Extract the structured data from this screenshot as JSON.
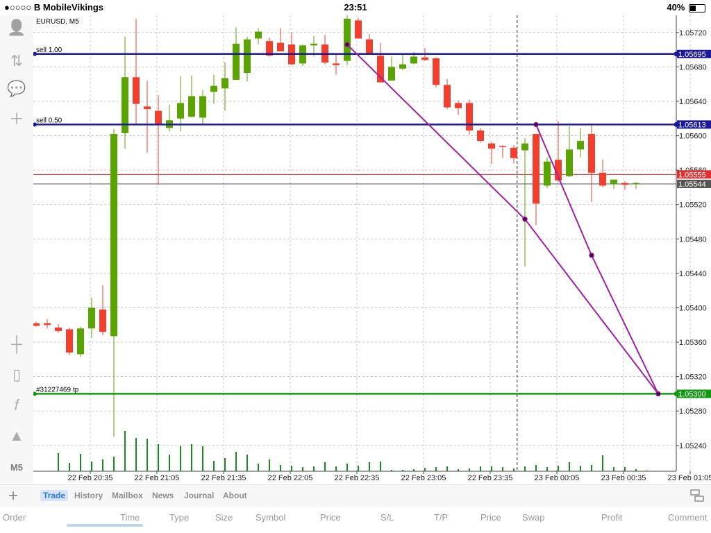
{
  "status_bar": {
    "carrier": "●○○○○ B MobileVikings",
    "time": "23:51",
    "battery": "40%",
    "battery_level": 0.4
  },
  "chart": {
    "symbol_label": "EURUSD, M5",
    "order_lines": [
      {
        "label": "sell 1.00",
        "price": 1.05695,
        "price_text": "1.05695",
        "color": "#1a1a9a"
      },
      {
        "label": "sell 0.50",
        "price": 1.05613,
        "price_text": "1.05613",
        "color": "#1a1a9a"
      },
      {
        "label": "#31227469 tp",
        "price": 1.053,
        "price_text": "1.05300",
        "color": "#119911"
      }
    ],
    "ask_line": {
      "price": 1.05555,
      "price_text": "1.05555",
      "color": "#e03030"
    },
    "bid_line": {
      "price": 1.05544,
      "price_text": "1.05544",
      "color": "#555555"
    }
  },
  "chart_data": {
    "type": "candlestick",
    "symbol": "EURUSD",
    "timeframe": "M5",
    "y_ticks": [
      "1.05720",
      "1.05680",
      "1.05640",
      "1.05600",
      "1.05560",
      "1.05520",
      "1.05480",
      "1.05440",
      "1.05400",
      "1.05360",
      "1.05320",
      "1.05280",
      "1.05240"
    ],
    "x_ticks": [
      "22 Feb 20:35",
      "22 Feb 21:05",
      "22 Feb 21:35",
      "22 Feb 22:05",
      "22 Feb 22:35",
      "22 Feb 23:05",
      "22 Feb 23:35",
      "23 Feb 00:05",
      "23 Feb 00:35",
      "23 Feb 01:05"
    ],
    "ylim": [
      1.0521,
      1.0574
    ],
    "grid": true,
    "candles": [
      {
        "o": 1.05382,
        "h": 1.05384,
        "l": 1.05378,
        "c": 1.05379
      },
      {
        "o": 1.05382,
        "h": 1.05387,
        "l": 1.05376,
        "c": 1.0538
      },
      {
        "o": 1.05377,
        "h": 1.05381,
        "l": 1.05371,
        "c": 1.05373
      },
      {
        "o": 1.05375,
        "h": 1.05377,
        "l": 1.05345,
        "c": 1.05348
      },
      {
        "o": 1.05346,
        "h": 1.05378,
        "l": 1.05343,
        "c": 1.05376
      },
      {
        "o": 1.05376,
        "h": 1.05412,
        "l": 1.05365,
        "c": 1.054
      },
      {
        "o": 1.05398,
        "h": 1.05426,
        "l": 1.05368,
        "c": 1.05372
      },
      {
        "o": 1.05367,
        "h": 1.05608,
        "l": 1.0525,
        "c": 1.05602
      },
      {
        "o": 1.05603,
        "h": 1.05715,
        "l": 1.05585,
        "c": 1.05668
      },
      {
        "o": 1.05668,
        "h": 1.05736,
        "l": 1.05612,
        "c": 1.05637
      },
      {
        "o": 1.05634,
        "h": 1.05664,
        "l": 1.0558,
        "c": 1.05631
      },
      {
        "o": 1.05629,
        "h": 1.05647,
        "l": 1.05543,
        "c": 1.05614
      },
      {
        "o": 1.05609,
        "h": 1.05636,
        "l": 1.05605,
        "c": 1.05618
      },
      {
        "o": 1.0562,
        "h": 1.05669,
        "l": 1.05605,
        "c": 1.05638
      },
      {
        "o": 1.05622,
        "h": 1.0567,
        "l": 1.05621,
        "c": 1.05646
      },
      {
        "o": 1.05621,
        "h": 1.05653,
        "l": 1.05612,
        "c": 1.05646
      },
      {
        "o": 1.05651,
        "h": 1.05671,
        "l": 1.05637,
        "c": 1.05658
      },
      {
        "o": 1.05655,
        "h": 1.05685,
        "l": 1.05629,
        "c": 1.05667
      },
      {
        "o": 1.05665,
        "h": 1.05726,
        "l": 1.05665,
        "c": 1.05707
      },
      {
        "o": 1.05673,
        "h": 1.05715,
        "l": 1.05663,
        "c": 1.05712
      },
      {
        "o": 1.05713,
        "h": 1.05725,
        "l": 1.05706,
        "c": 1.05721
      },
      {
        "o": 1.0571,
        "h": 1.05714,
        "l": 1.05692,
        "c": 1.05693
      },
      {
        "o": 1.05708,
        "h": 1.05725,
        "l": 1.05701,
        "c": 1.05698
      },
      {
        "o": 1.05706,
        "h": 1.0572,
        "l": 1.05682,
        "c": 1.05683
      },
      {
        "o": 1.05684,
        "h": 1.05706,
        "l": 1.05681,
        "c": 1.05705
      },
      {
        "o": 1.05705,
        "h": 1.05716,
        "l": 1.05692,
        "c": 1.05707
      },
      {
        "o": 1.05706,
        "h": 1.05717,
        "l": 1.05683,
        "c": 1.05685
      },
      {
        "o": 1.05684,
        "h": 1.05694,
        "l": 1.05671,
        "c": 1.05682
      },
      {
        "o": 1.05687,
        "h": 1.0574,
        "l": 1.05682,
        "c": 1.05736
      },
      {
        "o": 1.05734,
        "h": 1.05737,
        "l": 1.05713,
        "c": 1.05713
      },
      {
        "o": 1.05712,
        "h": 1.05718,
        "l": 1.05695,
        "c": 1.05694
      },
      {
        "o": 1.05693,
        "h": 1.05708,
        "l": 1.05662,
        "c": 1.05662
      },
      {
        "o": 1.05664,
        "h": 1.05692,
        "l": 1.05664,
        "c": 1.0568
      },
      {
        "o": 1.05678,
        "h": 1.05696,
        "l": 1.05676,
        "c": 1.05683
      },
      {
        "o": 1.05684,
        "h": 1.05697,
        "l": 1.05683,
        "c": 1.05692
      },
      {
        "o": 1.05691,
        "h": 1.05702,
        "l": 1.05687,
        "c": 1.05688
      },
      {
        "o": 1.0569,
        "h": 1.05691,
        "l": 1.05656,
        "c": 1.05659
      },
      {
        "o": 1.05659,
        "h": 1.05666,
        "l": 1.05631,
        "c": 1.05633
      },
      {
        "o": 1.05638,
        "h": 1.05641,
        "l": 1.05624,
        "c": 1.05632
      },
      {
        "o": 1.05638,
        "h": 1.05642,
        "l": 1.05601,
        "c": 1.05606
      },
      {
        "o": 1.05606,
        "h": 1.05609,
        "l": 1.05592,
        "c": 1.05594
      },
      {
        "o": 1.05591,
        "h": 1.05593,
        "l": 1.05567,
        "c": 1.05585
      },
      {
        "o": 1.05588,
        "h": 1.05589,
        "l": 1.05574,
        "c": 1.05587
      },
      {
        "o": 1.05586,
        "h": 1.05589,
        "l": 1.05568,
        "c": 1.05574
      },
      {
        "o": 1.05583,
        "h": 1.05597,
        "l": 1.05448,
        "c": 1.05591
      },
      {
        "o": 1.05602,
        "h": 1.05602,
        "l": 1.05496,
        "c": 1.05521
      },
      {
        "o": 1.05542,
        "h": 1.05575,
        "l": 1.05539,
        "c": 1.0557
      },
      {
        "o": 1.05572,
        "h": 1.05617,
        "l": 1.05546,
        "c": 1.05548
      },
      {
        "o": 1.05553,
        "h": 1.05611,
        "l": 1.05552,
        "c": 1.05584
      },
      {
        "o": 1.05584,
        "h": 1.05609,
        "l": 1.05575,
        "c": 1.05594
      },
      {
        "o": 1.05602,
        "h": 1.05613,
        "l": 1.05523,
        "c": 1.05557
      },
      {
        "o": 1.05557,
        "h": 1.05572,
        "l": 1.0554,
        "c": 1.05542
      },
      {
        "o": 1.05544,
        "h": 1.05549,
        "l": 1.05538,
        "c": 1.05549
      },
      {
        "o": 1.05545,
        "h": 1.05547,
        "l": 1.05537,
        "c": 1.05543
      },
      {
        "o": 1.05544,
        "h": 1.05546,
        "l": 1.05538,
        "c": 1.05545
      }
    ],
    "volumes": [
      0,
      0,
      0.26,
      0.12,
      0.25,
      0.14,
      0.17,
      0.21,
      0.58,
      0.48,
      0.47,
      0.39,
      0.24,
      0.36,
      0.39,
      0.36,
      0.15,
      0.19,
      0.28,
      0.24,
      0.11,
      0.17,
      0.09,
      0.08,
      0.06,
      0.07,
      0.13,
      0.07,
      0.11,
      0.08,
      0.13,
      0.14,
      0.02,
      0.02,
      0.03,
      0.05,
      0.06,
      0.07,
      0.03,
      0.04,
      0.07,
      0.07,
      0.06,
      0.04,
      0.07,
      0.09,
      0.06,
      0.08,
      0.13,
      0.08,
      0.09,
      0.23,
      0.06,
      0.06,
      0.03,
      0.01
    ],
    "trendlines": [
      {
        "from": [
          28,
          1.05706
        ],
        "to": [
          44,
          1.05503
        ],
        "color": "#a020a0"
      },
      {
        "from": [
          44,
          1.05503
        ],
        "to": [
          56,
          1.053
        ],
        "color": "#a020a0"
      },
      {
        "from": [
          45,
          1.05613
        ],
        "to": [
          50,
          1.05461
        ],
        "color": "#a020a0"
      },
      {
        "from": [
          50,
          1.05461
        ],
        "to": [
          56,
          1.053
        ],
        "color": "#a020a0"
      }
    ],
    "cursor_index": 43.3
  },
  "left_toolbar": {
    "items": [
      {
        "name": "account-icon",
        "glyph": "👤"
      },
      {
        "name": "quotes-icon",
        "glyph": "⇅"
      },
      {
        "name": "chat-icon",
        "glyph": "💬"
      },
      {
        "name": "new-order-icon",
        "glyph": "＋"
      },
      {
        "name": "crosshair-icon",
        "glyph": "┼"
      },
      {
        "name": "chart-type-icon",
        "glyph": "▯"
      },
      {
        "name": "indicators-icon",
        "glyph": "𝑓"
      },
      {
        "name": "objects-icon",
        "glyph": "▲"
      }
    ],
    "timeframe_label": "M5"
  },
  "bottom_tabs": [
    {
      "label": "Trade",
      "active": true
    },
    {
      "label": "History",
      "active": false
    },
    {
      "label": "Mailbox",
      "active": false
    },
    {
      "label": "News",
      "active": false
    },
    {
      "label": "Journal",
      "active": false
    },
    {
      "label": "About",
      "active": false
    }
  ],
  "table_headers": [
    "Order",
    "Time",
    "Type",
    "Size",
    "Symbol",
    "Price",
    "S/L",
    "T/P",
    "Price",
    "Swap",
    "Profit",
    "Comment"
  ],
  "colors": {
    "bull": "#5aa400",
    "bear": "#f23e2c",
    "grid": "#c8c8c8",
    "volume": "#1a8a1a"
  }
}
